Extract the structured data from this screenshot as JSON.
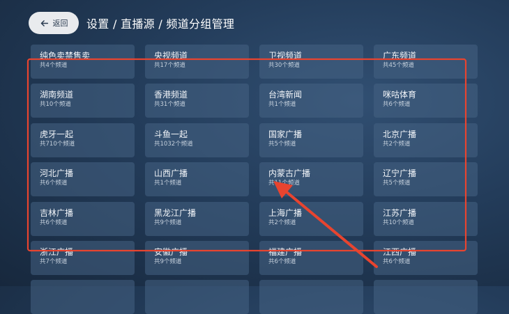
{
  "header": {
    "back_label": "返回",
    "breadcrumb": "设置 / 直播源 / 频道分组管理"
  },
  "groups": [
    {
      "title": "纯色卖禁售卖",
      "count": "共4个频道"
    },
    {
      "title": "央视频道",
      "count": "共17个频道"
    },
    {
      "title": "卫视频道",
      "count": "共30个频道"
    },
    {
      "title": "广东频道",
      "count": "共45个频道"
    },
    {
      "title": "湖南频道",
      "count": "共10个频道"
    },
    {
      "title": "香港频道",
      "count": "共31个频道"
    },
    {
      "title": "台湾新闻",
      "count": "共1个频道"
    },
    {
      "title": "咪咕体育",
      "count": "共6个频道"
    },
    {
      "title": "虎牙一起",
      "count": "共710个频道"
    },
    {
      "title": "斗鱼一起",
      "count": "共1032个频道"
    },
    {
      "title": "国家广播",
      "count": "共5个频道"
    },
    {
      "title": "北京广播",
      "count": "共2个频道"
    },
    {
      "title": "河北广播",
      "count": "共6个频道"
    },
    {
      "title": "山西广播",
      "count": "共1个频道"
    },
    {
      "title": "内蒙古广播",
      "count": "共11个频道"
    },
    {
      "title": "辽宁广播",
      "count": "共5个频道"
    },
    {
      "title": "吉林广播",
      "count": "共6个频道"
    },
    {
      "title": "黑龙江广播",
      "count": "共9个频道"
    },
    {
      "title": "上海广播",
      "count": "共2个频道"
    },
    {
      "title": "江苏广播",
      "count": "共10个频道"
    },
    {
      "title": "浙江广播",
      "count": "共7个频道"
    },
    {
      "title": "安徽广播",
      "count": "共9个频道"
    },
    {
      "title": "福建广播",
      "count": "共6个频道"
    },
    {
      "title": "江西广播",
      "count": "共6个频道"
    },
    {
      "title": "",
      "count": ""
    },
    {
      "title": "",
      "count": ""
    },
    {
      "title": "",
      "count": ""
    },
    {
      "title": "",
      "count": ""
    }
  ],
  "colors": {
    "annotation_red": "#e8442f",
    "back_button_bg": "#e9ebee"
  },
  "icons": {
    "back": "arrow-left-icon"
  }
}
